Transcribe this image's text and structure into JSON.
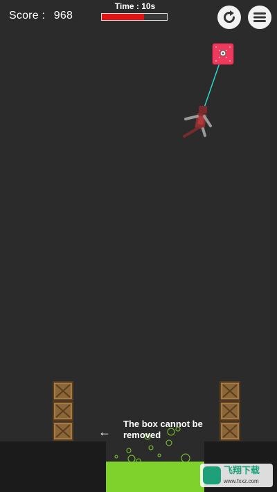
{
  "hud": {
    "score_label": "Score :",
    "score_value": "968",
    "time_label": "Time : 10s",
    "time_remaining_fraction": 0.65
  },
  "buttons": {
    "restart_icon": "restart-icon",
    "menu_icon": "hamburger-menu-icon"
  },
  "hint": {
    "line1": "The box cannot be",
    "line2": "removed",
    "arrow": "←"
  },
  "watermark": {
    "text": "飞翔下载",
    "domain": "www.fxxz.com"
  },
  "colors": {
    "background": "#2b2b2b",
    "timer_fill": "#e01414",
    "acid": "#7fd12c",
    "anchor_box": "#ef3a5d",
    "rope": "#2fd6d0"
  }
}
